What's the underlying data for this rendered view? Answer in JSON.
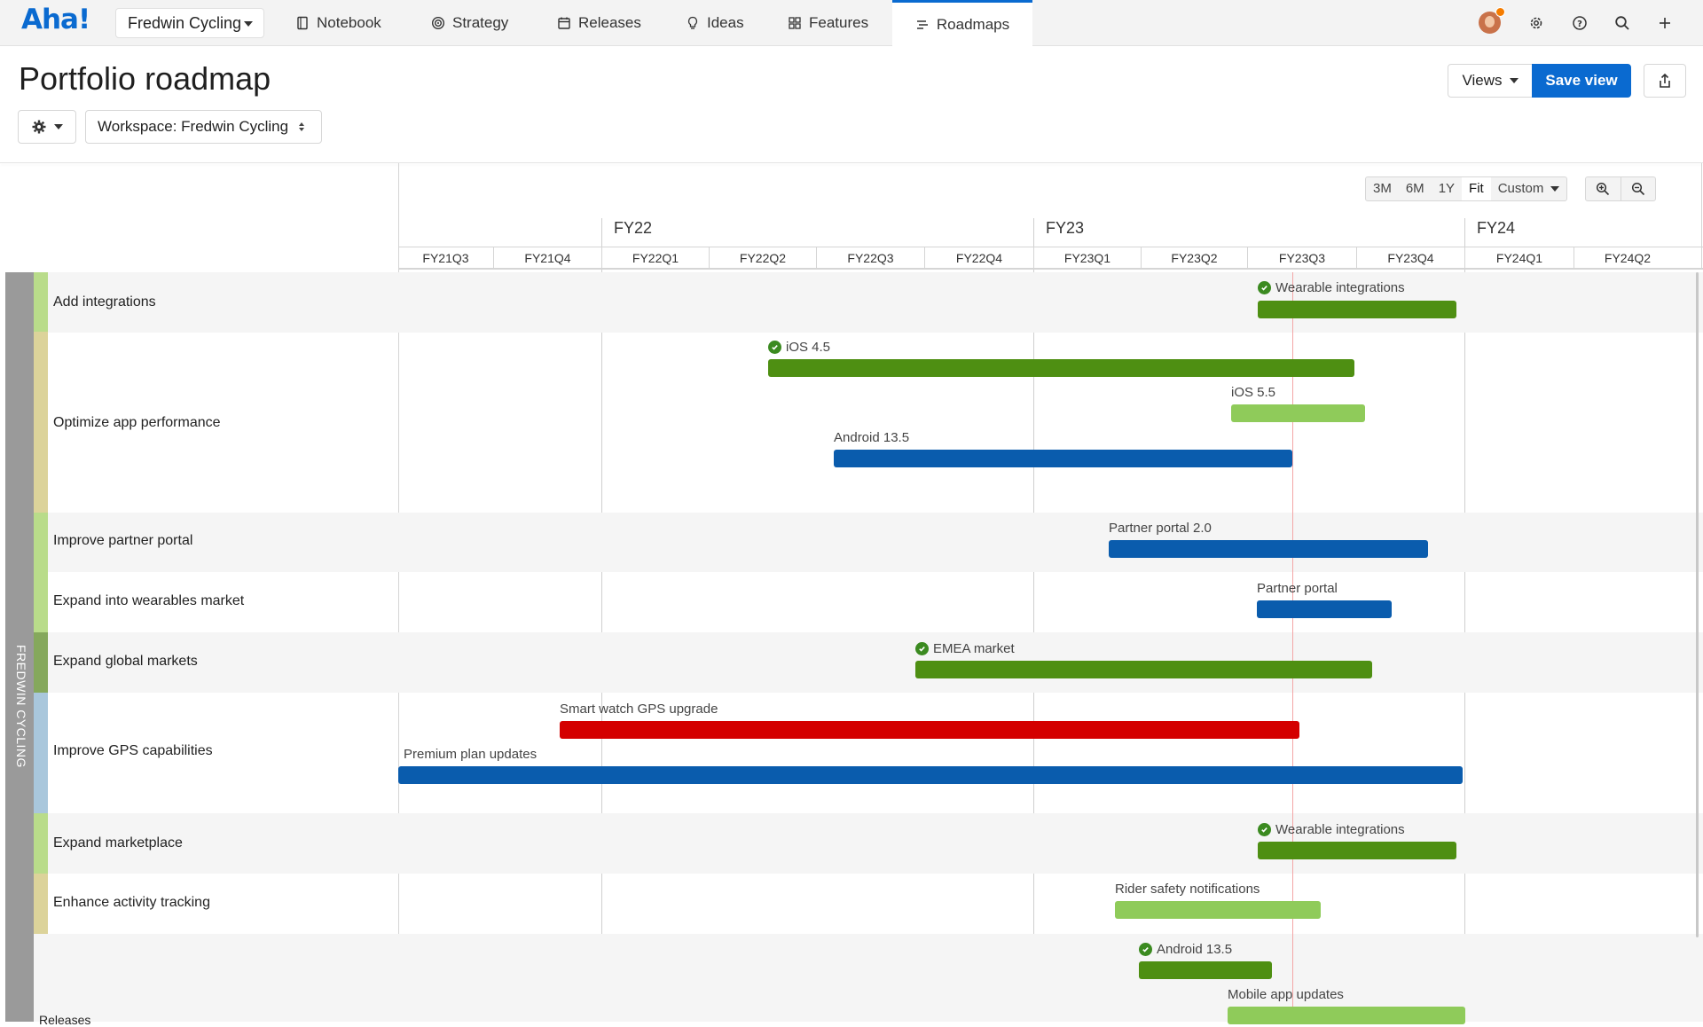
{
  "app": {
    "logo": "Aha!",
    "workspace": "Fredwin Cycling"
  },
  "nav": [
    {
      "label": "Notebook",
      "icon": "notebook-icon"
    },
    {
      "label": "Strategy",
      "icon": "target-icon"
    },
    {
      "label": "Releases",
      "icon": "calendar-icon"
    },
    {
      "label": "Ideas",
      "icon": "lightbulb-icon"
    },
    {
      "label": "Features",
      "icon": "grid-icon"
    },
    {
      "label": "Roadmaps",
      "icon": "roadmap-icon",
      "active": true
    }
  ],
  "page": {
    "title": "Portfolio roadmap",
    "views_label": "Views",
    "save_label": "Save view",
    "workspace_filter": "Workspace: Fredwin Cycling"
  },
  "timeline": {
    "zoom_options": [
      "3M",
      "6M",
      "1Y",
      "Fit",
      "Custom"
    ],
    "zoom_selected": "Fit",
    "years": [
      "FY22",
      "FY23",
      "FY24"
    ],
    "quarters": [
      "FY21Q3",
      "FY21Q4",
      "FY22Q1",
      "FY22Q2",
      "FY22Q3",
      "FY22Q4",
      "FY23Q1",
      "FY23Q2",
      "FY23Q3",
      "FY23Q4",
      "FY24Q1",
      "FY24Q2"
    ]
  },
  "group_label": "FREDWIN CYCLING",
  "rows": [
    {
      "label": "Add integrations",
      "tick": "#b9dc8a"
    },
    {
      "label": "Optimize app performance",
      "tick": "#dcd39a"
    },
    {
      "label": "Improve partner portal",
      "tick": "#b9dc8a"
    },
    {
      "label": "Expand into wearables market",
      "tick": "#b9dc8a"
    },
    {
      "label": "Expand global markets",
      "tick": "#85a85c"
    },
    {
      "label": "Improve GPS capabilities",
      "tick": "#a9c7dc"
    },
    {
      "label": "Expand marketplace",
      "tick": "#b9dc8a"
    },
    {
      "label": "Enhance activity tracking",
      "tick": "#dcd39a"
    }
  ],
  "bars": [
    {
      "label": "Wearable integrations",
      "done": true,
      "color": "#4e8f12"
    },
    {
      "label": "iOS 4.5",
      "done": true,
      "color": "#4e8f12"
    },
    {
      "label": "iOS 5.5",
      "done": false,
      "color": "#8fcb5a"
    },
    {
      "label": "Android 13.5",
      "done": false,
      "color": "#0a5cad"
    },
    {
      "label": "Partner portal 2.0",
      "done": false,
      "color": "#0a5cad"
    },
    {
      "label": "Partner portal",
      "done": false,
      "color": "#0a5cad"
    },
    {
      "label": "EMEA market",
      "done": true,
      "color": "#4e8f12"
    },
    {
      "label": "Smart watch GPS upgrade",
      "done": false,
      "color": "#d40000"
    },
    {
      "label": "Premium plan updates",
      "done": false,
      "color": "#0a5cad"
    },
    {
      "label": "Wearable integrations",
      "done": true,
      "color": "#4e8f12"
    },
    {
      "label": "Rider safety notifications",
      "done": false,
      "color": "#8fcb5a"
    },
    {
      "label": "Android 13.5",
      "done": true,
      "color": "#4e8f12"
    },
    {
      "label": "Mobile app updates",
      "done": false,
      "color": "#8fcb5a"
    }
  ],
  "releases_label": "Releases"
}
